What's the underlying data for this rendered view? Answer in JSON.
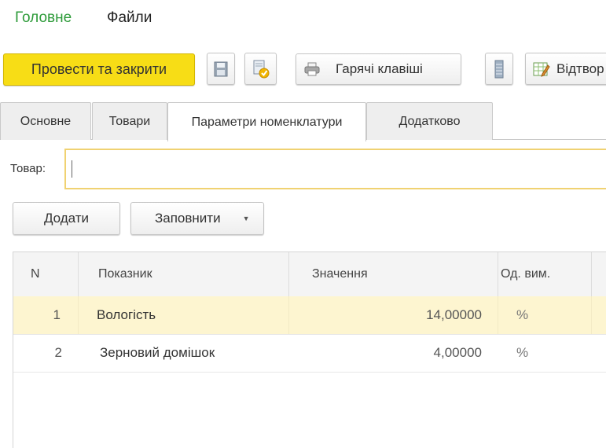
{
  "top_nav": {
    "home": "Головне",
    "files": "Файли"
  },
  "toolbar": {
    "post_close": "Провести та закрити",
    "hotkeys": "Гарячі клавіші",
    "display": "Відтвор"
  },
  "tabs": [
    {
      "label": "Основне"
    },
    {
      "label": "Товари"
    },
    {
      "label": "Параметри номенклатури"
    },
    {
      "label": "Додатково"
    }
  ],
  "product_field": {
    "label": "Товар:",
    "value": ""
  },
  "actions": {
    "add": "Додати",
    "fill": "Заповнити"
  },
  "table": {
    "headers": {
      "n": "N",
      "indicator": "Показник",
      "value": "Значення",
      "unit": "Од. вим."
    },
    "rows": [
      {
        "n": "1",
        "indicator": "Вологість",
        "value": "14,00000",
        "unit": "%"
      },
      {
        "n": "2",
        "indicator": "Зерновий домішок",
        "value": "4,00000",
        "unit": "%"
      }
    ]
  },
  "colors": {
    "accent_green": "#2e9b3a",
    "primary_yellow": "#f7dd16",
    "selected_row": "#fdf5d0",
    "input_border": "#f0d272"
  }
}
